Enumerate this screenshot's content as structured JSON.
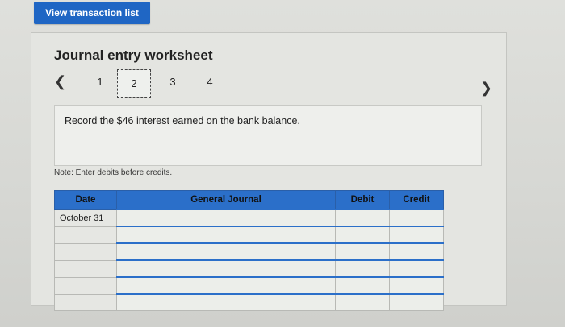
{
  "header": {
    "view_button": "View transaction list"
  },
  "worksheet": {
    "title": "Journal entry worksheet",
    "pages": [
      "1",
      "2",
      "3",
      "4"
    ],
    "active_page": "2",
    "instruction": "Record the $46 interest earned on the bank balance.",
    "note": "Note: Enter debits before credits."
  },
  "table": {
    "headers": {
      "date": "Date",
      "journal": "General Journal",
      "debit": "Debit",
      "credit": "Credit"
    },
    "rows": [
      {
        "date": "October 31"
      },
      {
        "date": ""
      },
      {
        "date": ""
      },
      {
        "date": ""
      },
      {
        "date": ""
      },
      {
        "date": ""
      }
    ]
  },
  "icons": {
    "prev": "chevron-left-icon",
    "next": "chevron-right-icon"
  },
  "colors": {
    "accent": "#2b6fc9",
    "button": "#1f66c4"
  }
}
